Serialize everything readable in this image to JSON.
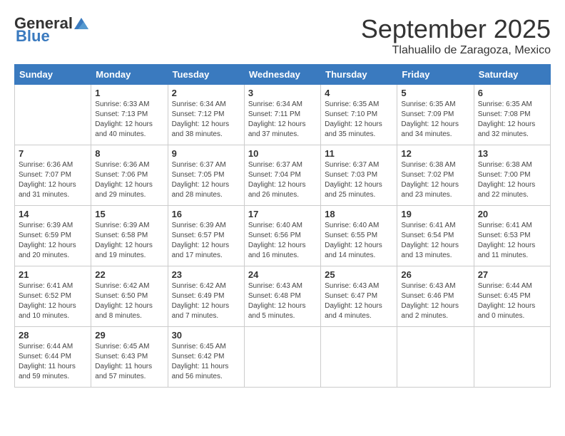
{
  "logo": {
    "general": "General",
    "blue": "Blue"
  },
  "title": "September 2025",
  "location": "Tlahualilo de Zaragoza, Mexico",
  "days_of_week": [
    "Sunday",
    "Monday",
    "Tuesday",
    "Wednesday",
    "Thursday",
    "Friday",
    "Saturday"
  ],
  "weeks": [
    [
      {
        "day": "",
        "info": ""
      },
      {
        "day": "1",
        "info": "Sunrise: 6:33 AM\nSunset: 7:13 PM\nDaylight: 12 hours\nand 40 minutes."
      },
      {
        "day": "2",
        "info": "Sunrise: 6:34 AM\nSunset: 7:12 PM\nDaylight: 12 hours\nand 38 minutes."
      },
      {
        "day": "3",
        "info": "Sunrise: 6:34 AM\nSunset: 7:11 PM\nDaylight: 12 hours\nand 37 minutes."
      },
      {
        "day": "4",
        "info": "Sunrise: 6:35 AM\nSunset: 7:10 PM\nDaylight: 12 hours\nand 35 minutes."
      },
      {
        "day": "5",
        "info": "Sunrise: 6:35 AM\nSunset: 7:09 PM\nDaylight: 12 hours\nand 34 minutes."
      },
      {
        "day": "6",
        "info": "Sunrise: 6:35 AM\nSunset: 7:08 PM\nDaylight: 12 hours\nand 32 minutes."
      }
    ],
    [
      {
        "day": "7",
        "info": "Sunrise: 6:36 AM\nSunset: 7:07 PM\nDaylight: 12 hours\nand 31 minutes."
      },
      {
        "day": "8",
        "info": "Sunrise: 6:36 AM\nSunset: 7:06 PM\nDaylight: 12 hours\nand 29 minutes."
      },
      {
        "day": "9",
        "info": "Sunrise: 6:37 AM\nSunset: 7:05 PM\nDaylight: 12 hours\nand 28 minutes."
      },
      {
        "day": "10",
        "info": "Sunrise: 6:37 AM\nSunset: 7:04 PM\nDaylight: 12 hours\nand 26 minutes."
      },
      {
        "day": "11",
        "info": "Sunrise: 6:37 AM\nSunset: 7:03 PM\nDaylight: 12 hours\nand 25 minutes."
      },
      {
        "day": "12",
        "info": "Sunrise: 6:38 AM\nSunset: 7:02 PM\nDaylight: 12 hours\nand 23 minutes."
      },
      {
        "day": "13",
        "info": "Sunrise: 6:38 AM\nSunset: 7:00 PM\nDaylight: 12 hours\nand 22 minutes."
      }
    ],
    [
      {
        "day": "14",
        "info": "Sunrise: 6:39 AM\nSunset: 6:59 PM\nDaylight: 12 hours\nand 20 minutes."
      },
      {
        "day": "15",
        "info": "Sunrise: 6:39 AM\nSunset: 6:58 PM\nDaylight: 12 hours\nand 19 minutes."
      },
      {
        "day": "16",
        "info": "Sunrise: 6:39 AM\nSunset: 6:57 PM\nDaylight: 12 hours\nand 17 minutes."
      },
      {
        "day": "17",
        "info": "Sunrise: 6:40 AM\nSunset: 6:56 PM\nDaylight: 12 hours\nand 16 minutes."
      },
      {
        "day": "18",
        "info": "Sunrise: 6:40 AM\nSunset: 6:55 PM\nDaylight: 12 hours\nand 14 minutes."
      },
      {
        "day": "19",
        "info": "Sunrise: 6:41 AM\nSunset: 6:54 PM\nDaylight: 12 hours\nand 13 minutes."
      },
      {
        "day": "20",
        "info": "Sunrise: 6:41 AM\nSunset: 6:53 PM\nDaylight: 12 hours\nand 11 minutes."
      }
    ],
    [
      {
        "day": "21",
        "info": "Sunrise: 6:41 AM\nSunset: 6:52 PM\nDaylight: 12 hours\nand 10 minutes."
      },
      {
        "day": "22",
        "info": "Sunrise: 6:42 AM\nSunset: 6:50 PM\nDaylight: 12 hours\nand 8 minutes."
      },
      {
        "day": "23",
        "info": "Sunrise: 6:42 AM\nSunset: 6:49 PM\nDaylight: 12 hours\nand 7 minutes."
      },
      {
        "day": "24",
        "info": "Sunrise: 6:43 AM\nSunset: 6:48 PM\nDaylight: 12 hours\nand 5 minutes."
      },
      {
        "day": "25",
        "info": "Sunrise: 6:43 AM\nSunset: 6:47 PM\nDaylight: 12 hours\nand 4 minutes."
      },
      {
        "day": "26",
        "info": "Sunrise: 6:43 AM\nSunset: 6:46 PM\nDaylight: 12 hours\nand 2 minutes."
      },
      {
        "day": "27",
        "info": "Sunrise: 6:44 AM\nSunset: 6:45 PM\nDaylight: 12 hours\nand 0 minutes."
      }
    ],
    [
      {
        "day": "28",
        "info": "Sunrise: 6:44 AM\nSunset: 6:44 PM\nDaylight: 11 hours\nand 59 minutes."
      },
      {
        "day": "29",
        "info": "Sunrise: 6:45 AM\nSunset: 6:43 PM\nDaylight: 11 hours\nand 57 minutes."
      },
      {
        "day": "30",
        "info": "Sunrise: 6:45 AM\nSunset: 6:42 PM\nDaylight: 11 hours\nand 56 minutes."
      },
      {
        "day": "",
        "info": ""
      },
      {
        "day": "",
        "info": ""
      },
      {
        "day": "",
        "info": ""
      },
      {
        "day": "",
        "info": ""
      }
    ]
  ]
}
